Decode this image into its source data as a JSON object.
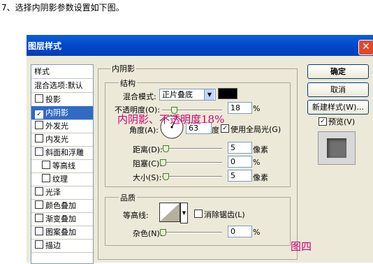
{
  "caption": "7、选择内阴影参数设置如下图。",
  "window": {
    "title": "图层样式",
    "close_icon": "close-icon"
  },
  "sidebar": {
    "header": "样式",
    "items": [
      {
        "label": "混合选项:默认",
        "checkbox": false,
        "selected": false
      },
      {
        "label": "投影",
        "checkbox": true,
        "checked": false
      },
      {
        "label": "内阴影",
        "checkbox": true,
        "checked": true,
        "selected": true
      },
      {
        "label": "外发光",
        "checkbox": true,
        "checked": false
      },
      {
        "label": "内发光",
        "checkbox": true,
        "checked": false
      },
      {
        "label": "斜面和浮雕",
        "checkbox": true,
        "checked": false
      },
      {
        "label": "等高线",
        "checkbox": true,
        "checked": false,
        "indent": true
      },
      {
        "label": "纹理",
        "checkbox": true,
        "checked": false,
        "indent": true
      },
      {
        "label": "光泽",
        "checkbox": true,
        "checked": false
      },
      {
        "label": "颜色叠加",
        "checkbox": true,
        "checked": false
      },
      {
        "label": "渐变叠加",
        "checkbox": true,
        "checked": false
      },
      {
        "label": "图案叠加",
        "checkbox": true,
        "checked": false
      },
      {
        "label": "描边",
        "checkbox": true,
        "checked": false
      }
    ]
  },
  "panel": {
    "title": "内阴影",
    "structure": {
      "legend": "结构",
      "blend_mode_label": "混合模式:",
      "blend_mode_value": "正片叠底",
      "blend_color": "#000000",
      "opacity_label": "不透明度(O):",
      "opacity_value": "18",
      "opacity_unit": "%",
      "angle_label": "角度(A):",
      "angle_value": "63",
      "angle_unit": "度",
      "global_light_label": "使用全局光(G)",
      "global_light_checked": true,
      "distance_label": "距离(D):",
      "distance_value": "5",
      "distance_unit": "像素",
      "choke_label": "阻塞(C):",
      "choke_value": "0",
      "choke_unit": "%",
      "size_label": "大小(S):",
      "size_value": "5",
      "size_unit": "像素"
    },
    "quality": {
      "legend": "品质",
      "contour_label": "等高线:",
      "antialias_label": "消除锯齿(L)",
      "antialias_checked": false,
      "noise_label": "杂色(N):",
      "noise_value": "0",
      "noise_unit": "%"
    }
  },
  "buttons": {
    "ok": "确定",
    "cancel": "取消",
    "new_style": "新建样式(W)...",
    "preview": "预览(V)",
    "preview_checked": true
  },
  "annotations": {
    "handwritten": "内阴影、不透明度18%",
    "figure": "图四"
  },
  "colors": {
    "selection": "#316ac5",
    "title_bar": "#0050d8",
    "annotation": "#d1006f"
  }
}
